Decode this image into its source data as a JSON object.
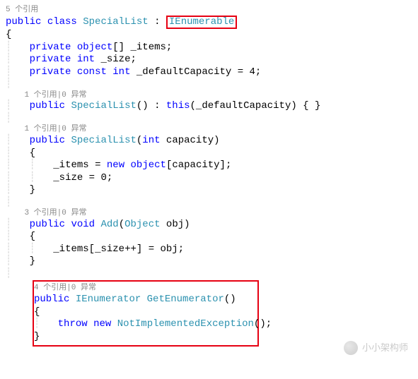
{
  "code": {
    "lens_class": "5 个引用",
    "mod_public": "public",
    "kw_class": "class",
    "class_name": "SpecialList",
    "colon": " : ",
    "iface": "IEnumerable",
    "open_brace": "{",
    "close_brace": "}",
    "field1_pre": "private",
    "field1_type": "object",
    "field1_rest": "[] _items;",
    "field2_pre": "private",
    "field2_type": "int",
    "field2_rest": " _size;",
    "field3_pre": "private",
    "field3_const": "const",
    "field3_type": "int",
    "field3_rest": " _defaultCapacity = 4;",
    "lens_ctor1": "1 个引用|0 异常",
    "ctor1_pre": "public",
    "ctor1_name": "SpecialList",
    "ctor1_sig": "() : ",
    "ctor1_this": "this",
    "ctor1_rest": "(_defaultCapacity) { }",
    "lens_ctor2": "1 个引用|0 异常",
    "ctor2_pre": "public",
    "ctor2_name": "SpecialList",
    "ctor2_open": "(",
    "ctor2_ptype": "int",
    "ctor2_pname": " capacity)",
    "ctor2_body1_a": "_items = ",
    "ctor2_body1_new": "new",
    "ctor2_body1_b": " ",
    "ctor2_body1_type": "object",
    "ctor2_body1_c": "[capacity];",
    "ctor2_body2": "_size = 0;",
    "lens_add": "3 个引用|0 异常",
    "add_pre": "public",
    "add_void": "void",
    "add_name": " Add",
    "add_open": "(",
    "add_ptype": "Object",
    "add_pname": " obj)",
    "add_body": "_items[_size++] = obj;",
    "lens_enum": "4 个引用|0 异常",
    "enum_pre": "public",
    "enum_ret": "IEnumerator",
    "enum_name": " GetEnumerator",
    "enum_sig": "()",
    "enum_throw": "throw",
    "enum_new": "new",
    "enum_ex": "NotImplementedException",
    "enum_rest": "();"
  },
  "watermark": {
    "text": "小小架构师"
  }
}
